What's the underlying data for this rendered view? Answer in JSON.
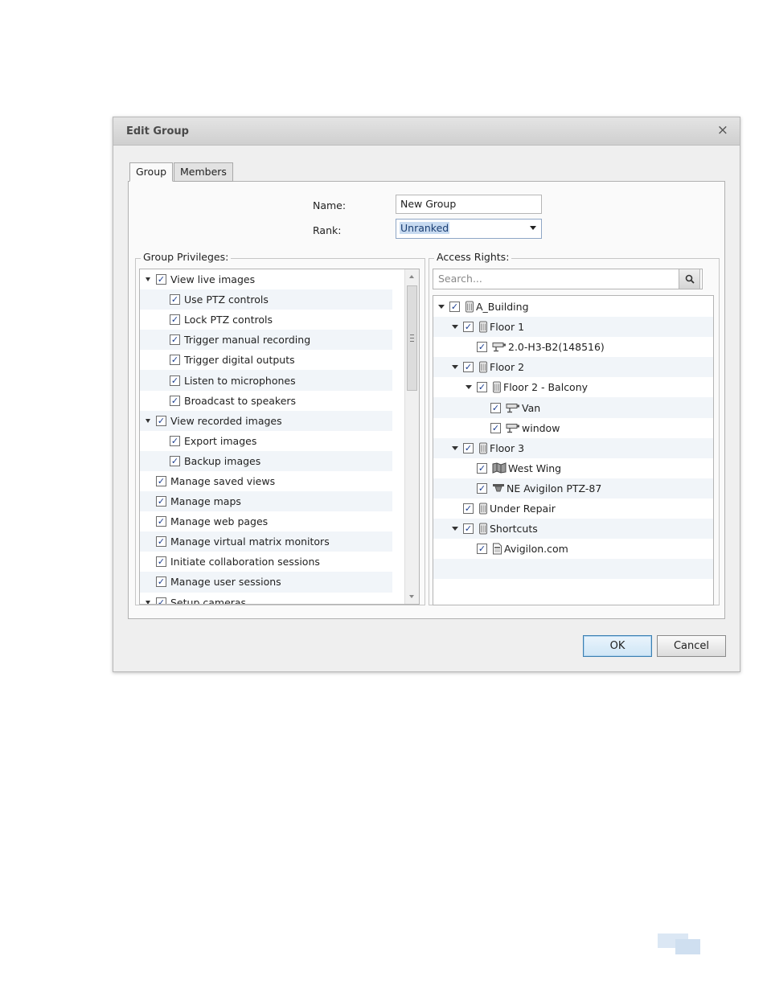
{
  "dialog": {
    "title": "Edit Group",
    "close_glyph": "×"
  },
  "tabs": [
    {
      "label": "Group",
      "active": true
    },
    {
      "label": "Members",
      "active": false
    }
  ],
  "form": {
    "name_label": "Name:",
    "name_value": "New Group",
    "rank_label": "Rank:",
    "rank_value": "Unranked"
  },
  "group_privileges": {
    "title": "Group Privileges:",
    "items": [
      {
        "label": "View live images",
        "level": 0,
        "expander": "open",
        "checked": true
      },
      {
        "label": "Use PTZ controls",
        "level": 1,
        "checked": true
      },
      {
        "label": "Lock PTZ controls",
        "level": 1,
        "checked": true
      },
      {
        "label": "Trigger manual recording",
        "level": 1,
        "checked": true
      },
      {
        "label": "Trigger digital outputs",
        "level": 1,
        "checked": true
      },
      {
        "label": "Listen to microphones",
        "level": 1,
        "checked": true
      },
      {
        "label": "Broadcast to speakers",
        "level": 1,
        "checked": true
      },
      {
        "label": "View recorded images",
        "level": 0,
        "expander": "open",
        "checked": true
      },
      {
        "label": "Export images",
        "level": 1,
        "checked": true
      },
      {
        "label": "Backup images",
        "level": 1,
        "checked": true
      },
      {
        "label": "Manage saved views",
        "level": 0,
        "checked": true
      },
      {
        "label": "Manage maps",
        "level": 0,
        "checked": true
      },
      {
        "label": "Manage web pages",
        "level": 0,
        "checked": true
      },
      {
        "label": "Manage virtual matrix monitors",
        "level": 0,
        "checked": true
      },
      {
        "label": "Initiate collaboration sessions",
        "level": 0,
        "checked": true
      },
      {
        "label": "Manage user sessions",
        "level": 0,
        "checked": true
      },
      {
        "label": "Setup cameras",
        "level": 0,
        "expander": "open",
        "checked": true
      }
    ]
  },
  "access_rights": {
    "title": "Access Rights:",
    "search_placeholder": "Search...",
    "items": [
      {
        "label": "A_Building",
        "level": 0,
        "expander": "down",
        "checked": true,
        "icon": "server-icon"
      },
      {
        "label": "Floor 1",
        "level": 1,
        "expander": "down",
        "checked": true,
        "icon": "server-icon"
      },
      {
        "label": "2.0-H3-B2(148516)",
        "level": 2,
        "checked": true,
        "icon": "camera-icon"
      },
      {
        "label": "Floor 2",
        "level": 1,
        "expander": "down",
        "checked": true,
        "icon": "server-icon"
      },
      {
        "label": "Floor 2 - Balcony",
        "level": 2,
        "expander": "down",
        "checked": true,
        "icon": "server-icon"
      },
      {
        "label": "Van",
        "level": 3,
        "checked": true,
        "icon": "camera-icon"
      },
      {
        "label": "window",
        "level": 3,
        "checked": true,
        "icon": "camera-icon"
      },
      {
        "label": "Floor 3",
        "level": 1,
        "expander": "down",
        "checked": true,
        "icon": "server-icon"
      },
      {
        "label": "West Wing",
        "level": 2,
        "checked": true,
        "icon": "map-icon"
      },
      {
        "label": "NE Avigilon PTZ-87",
        "level": 2,
        "checked": true,
        "icon": "ptz-camera-icon"
      },
      {
        "label": "Under Repair",
        "level": 1,
        "checked": true,
        "icon": "server-icon"
      },
      {
        "label": "Shortcuts",
        "level": 1,
        "expander": "down",
        "checked": true,
        "icon": "server-icon"
      },
      {
        "label": "Avigilon.com",
        "level": 2,
        "checked": true,
        "icon": "web-page-icon"
      }
    ]
  },
  "buttons": {
    "ok_label": "OK",
    "cancel_label": "Cancel"
  },
  "checkmark_glyph": "✓"
}
